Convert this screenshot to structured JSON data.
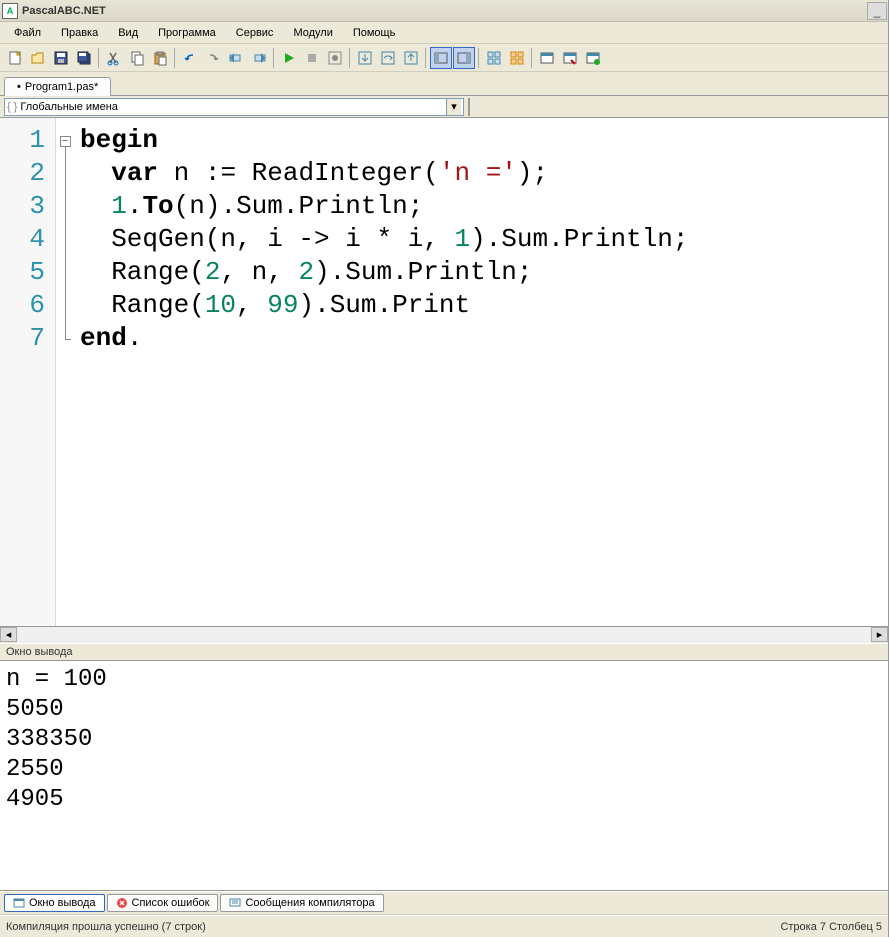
{
  "title": "PascalABC.NET",
  "menu": [
    "Файл",
    "Правка",
    "Вид",
    "Программа",
    "Сервис",
    "Модули",
    "Помощь"
  ],
  "tab": {
    "label": "Program1.pas*",
    "modified": true
  },
  "navDropdown": "Глобальные имена",
  "code": {
    "lineNumbers": [
      "1",
      "2",
      "3",
      "4",
      "5",
      "6",
      "7"
    ],
    "lines": [
      [
        {
          "t": "begin",
          "c": "kw"
        }
      ],
      [
        {
          "t": "  ",
          "c": ""
        },
        {
          "t": "var",
          "c": "kw"
        },
        {
          "t": " n := ReadInteger(",
          "c": ""
        },
        {
          "t": "'n ='",
          "c": "str"
        },
        {
          "t": ");",
          "c": ""
        }
      ],
      [
        {
          "t": "  ",
          "c": ""
        },
        {
          "t": "1",
          "c": "num"
        },
        {
          "t": ".",
          "c": ""
        },
        {
          "t": "To",
          "c": "kw"
        },
        {
          "t": "(n).Sum.Println;",
          "c": ""
        }
      ],
      [
        {
          "t": "  SeqGen(n, i -> i * i, ",
          "c": ""
        },
        {
          "t": "1",
          "c": "num"
        },
        {
          "t": ").Sum.Println;",
          "c": ""
        }
      ],
      [
        {
          "t": "  Range(",
          "c": ""
        },
        {
          "t": "2",
          "c": "num"
        },
        {
          "t": ", n, ",
          "c": ""
        },
        {
          "t": "2",
          "c": "num"
        },
        {
          "t": ").Sum.Println;",
          "c": ""
        }
      ],
      [
        {
          "t": "  Range(",
          "c": ""
        },
        {
          "t": "10",
          "c": "num"
        },
        {
          "t": ", ",
          "c": ""
        },
        {
          "t": "99",
          "c": "num"
        },
        {
          "t": ").Sum.Print",
          "c": ""
        }
      ],
      [
        {
          "t": "end",
          "c": "kw"
        },
        {
          "t": ".",
          "c": ""
        }
      ]
    ]
  },
  "outputHeader": "Окно вывода",
  "outputLines": [
    "n = 100",
    "5050",
    "338350",
    "2550",
    "4905"
  ],
  "bottomTabs": [
    {
      "label": "Окно вывода",
      "active": true,
      "icon": "window"
    },
    {
      "label": "Список ошибок",
      "active": false,
      "icon": "error"
    },
    {
      "label": "Сообщения компилятора",
      "active": false,
      "icon": "msg"
    }
  ],
  "status": {
    "left": "Компиляция прошла успешно (7 строк)",
    "right": "Строка  7 Столбец  5"
  }
}
